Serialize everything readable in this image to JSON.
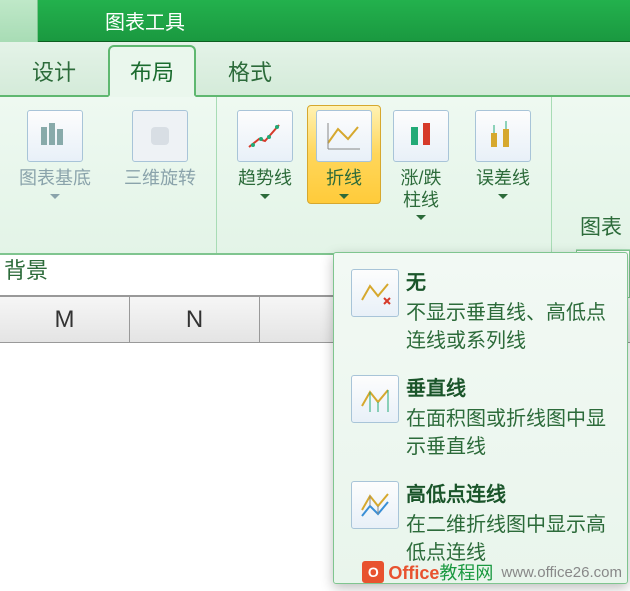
{
  "titlebar": {
    "title": "图表工具"
  },
  "tabs": {
    "design": "设计",
    "layout": "布局",
    "format": "格式"
  },
  "ribbon": {
    "bg_group": {
      "chart_walls": "图表基底",
      "rotate3d": "三维旋转",
      "group_label": "背景"
    },
    "analysis": {
      "trendline": "趋势线",
      "lines": "折线",
      "updown": "涨/跌\n柱线",
      "error": "误差线"
    },
    "side": {
      "a": "图表",
      "b": "图表"
    }
  },
  "sheet": {
    "col_m": "M",
    "col_n": "N"
  },
  "menu": {
    "none": {
      "title": "无",
      "desc": "不显示垂直线、高低点连线或系列线"
    },
    "drop": {
      "title": "垂直线",
      "desc": "在面积图或折线图中显示垂直线"
    },
    "hilo": {
      "title": "高低点连线",
      "desc": "在二维折线图中显示高低点连线"
    }
  },
  "watermark": {
    "brand1": "Office",
    "brand2": "教程网",
    "url": "www.office26.com"
  }
}
